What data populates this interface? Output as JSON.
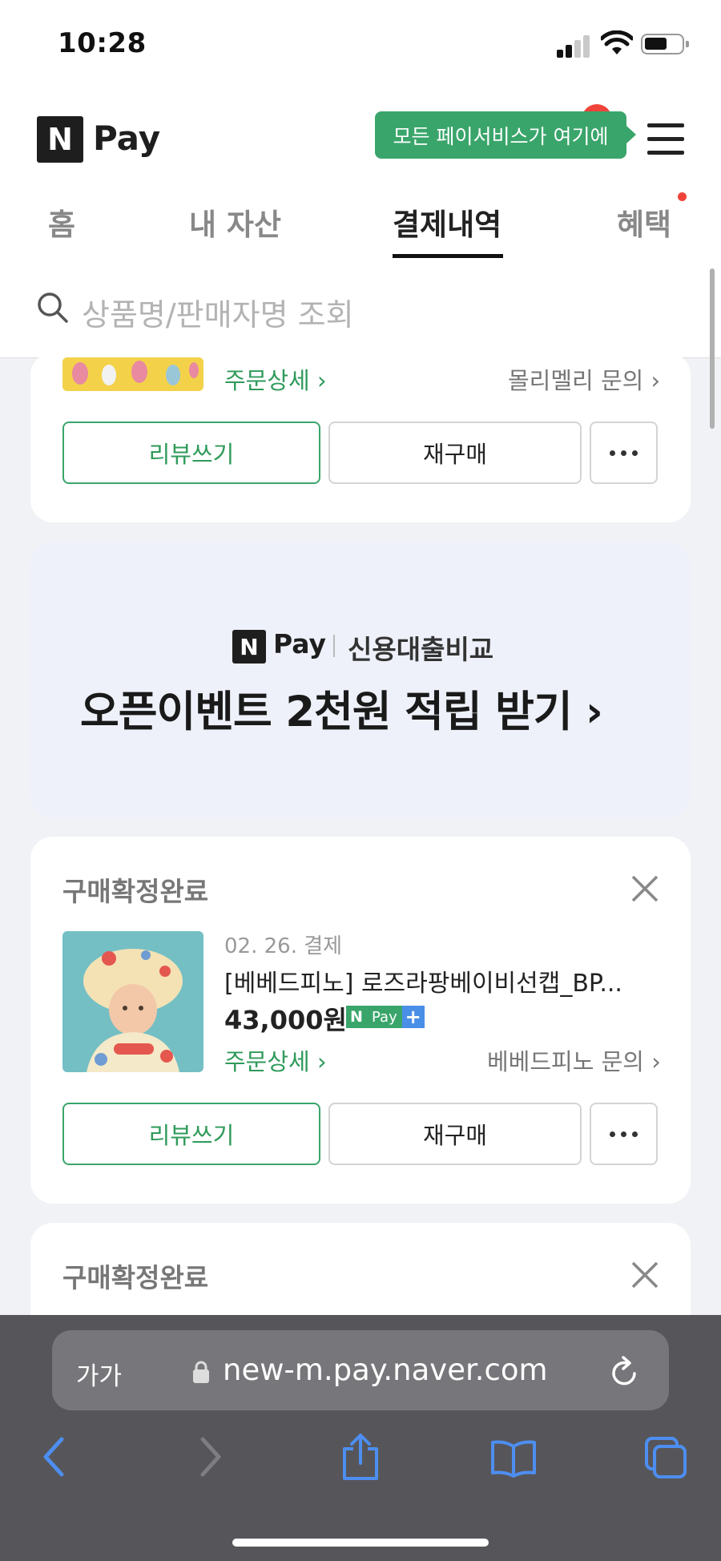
{
  "status_bar": {
    "time": "10:28"
  },
  "header": {
    "logo_letter": "N",
    "logo_text": "Pay",
    "tooltip": "모든 페이서비스가 여기에"
  },
  "tabs": [
    {
      "label": "홈"
    },
    {
      "label": "내 자산"
    },
    {
      "label": "결제내역"
    },
    {
      "label": "혜택"
    }
  ],
  "search": {
    "placeholder": "상품명/판매자명 조회"
  },
  "card1": {
    "order_detail": "주문상세 ›",
    "seller_inquiry": "몰리멜리 문의 ›",
    "review_btn": "리뷰쓰기",
    "rebuy_btn": "재구매"
  },
  "banner": {
    "logo_letter": "N",
    "logo_text": "Pay",
    "subtitle": "신용대출비교",
    "headline": "오픈이벤트 2천원 적립 받기 ›"
  },
  "card2": {
    "status": "구매확정완료",
    "date": "02. 26. 결제",
    "product": "[베베드피노] 로즈라팡베이비선캡_BP...",
    "price": "43,000원",
    "npay_badge": "Pay",
    "order_detail": "주문상세 ›",
    "seller_inquiry": "베베드피노 문의 ›",
    "review_btn": "리뷰쓰기",
    "rebuy_btn": "재구매"
  },
  "card3": {
    "status": "구매확정완료"
  },
  "browser": {
    "aa_label": "가가",
    "url": "new-m.pay.naver.com"
  }
}
